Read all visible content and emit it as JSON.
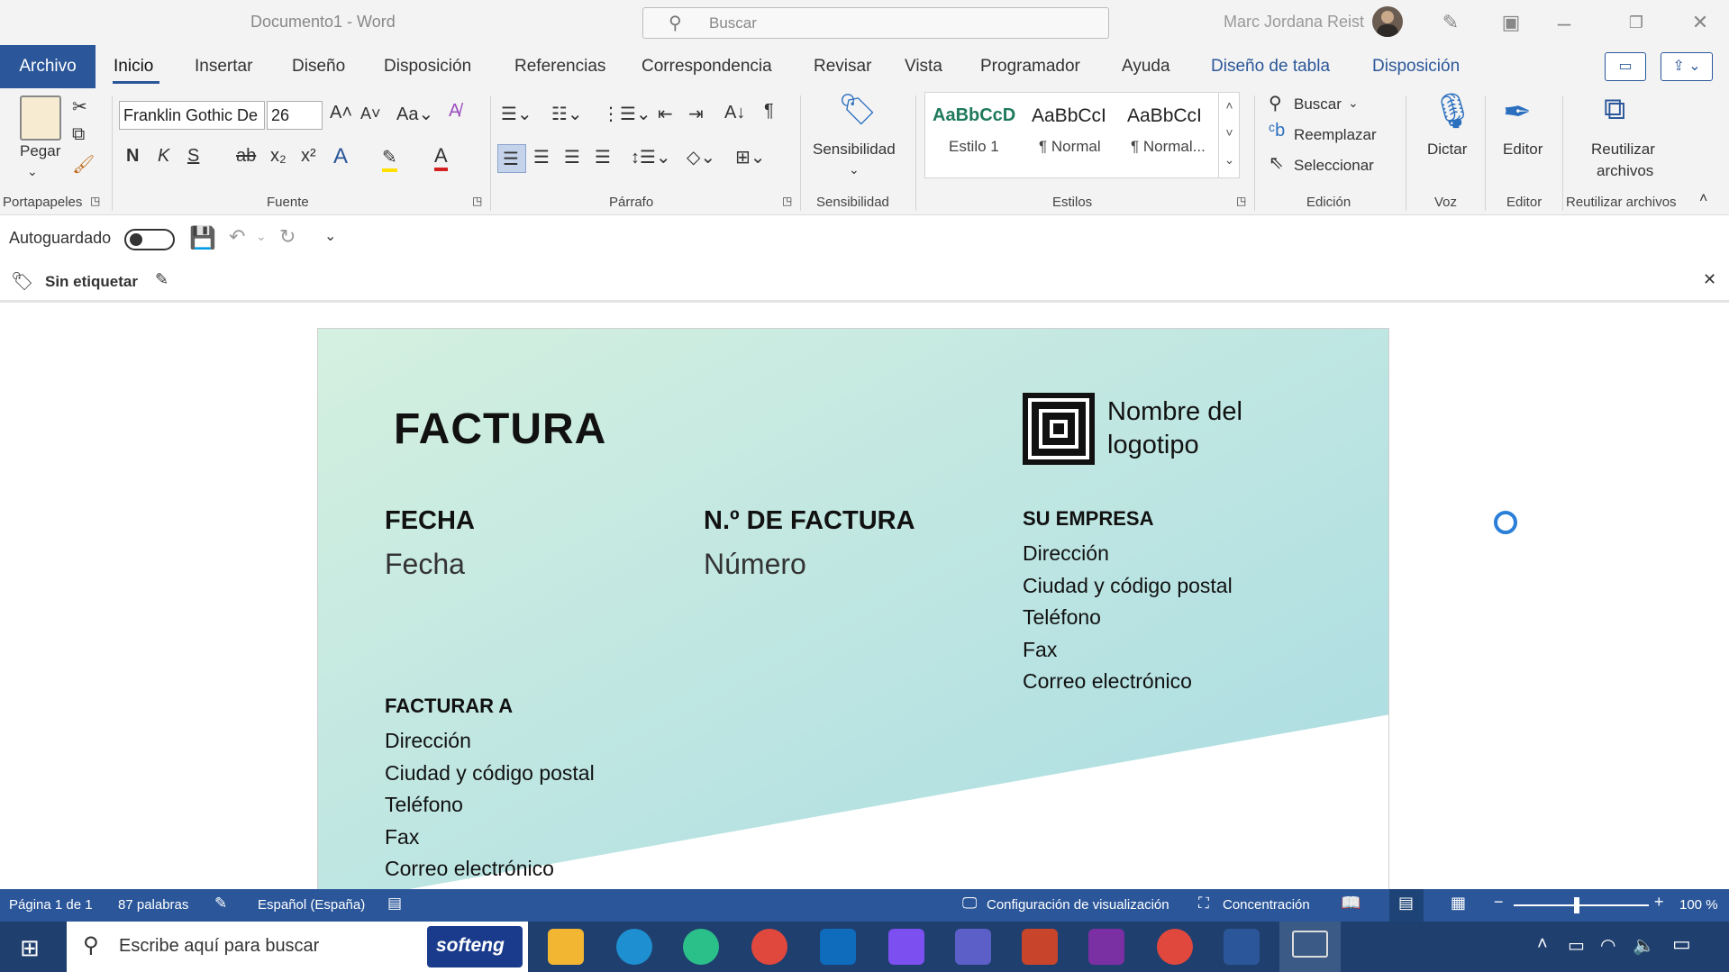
{
  "window": {
    "doc_title": "Documento1  -  Word",
    "search_placeholder": "Buscar",
    "user_name": "Marc Jordana Reist"
  },
  "tabs": [
    "Archivo",
    "Inicio",
    "Insertar",
    "Diseño",
    "Disposición",
    "Referencias",
    "Correspondencia",
    "Revisar",
    "Vista",
    "Programador",
    "Ayuda",
    "Diseño de tabla",
    "Disposición"
  ],
  "ribbon": {
    "clipboard": {
      "paste": "Pegar",
      "group": "Portapapeles"
    },
    "font": {
      "name": "Franklin Gothic De",
      "size": "26",
      "group": "Fuente",
      "bold": "N",
      "italic": "K",
      "underline": "S"
    },
    "paragraph": {
      "group": "Párrafo"
    },
    "sensitivity": {
      "button": "Sensibilidad",
      "group": "Sensibilidad"
    },
    "styles": {
      "group": "Estilos",
      "items": [
        {
          "preview": "AaBbCcD",
          "name": "Estilo 1"
        },
        {
          "preview": "AaBbCcI",
          "name": "¶ Normal"
        },
        {
          "preview": "AaBbCcI",
          "name": "¶ Normal..."
        }
      ]
    },
    "editing": {
      "find": "Buscar",
      "replace": "Reemplazar",
      "select": "Seleccionar",
      "group": "Edición"
    },
    "voice": {
      "dictate": "Dictar",
      "group": "Voz"
    },
    "editor": {
      "button": "Editor",
      "group": "Editor"
    },
    "reuse": {
      "button_line1": "Reutilizar",
      "button_line2": "archivos",
      "group": "Reutilizar archivos"
    }
  },
  "qat": {
    "autosave": "Autoguardado"
  },
  "labelbar": {
    "label": "Sin etiquetar"
  },
  "document": {
    "title": "FACTURA",
    "logo_line1": "Nombre del",
    "logo_line2": "logotipo",
    "fecha_label": "FECHA",
    "fecha_value": "Fecha",
    "invoice_label": "N.º DE FACTURA",
    "invoice_value": "Número",
    "company_label": "SU EMPRESA",
    "company_lines": [
      "Dirección",
      "Ciudad y código postal",
      "Teléfono",
      "Fax",
      "Correo electrónico"
    ],
    "billto_label": "FACTURAR A",
    "billto_lines": [
      "Dirección",
      "Ciudad y código postal",
      "Teléfono",
      "Fax",
      "Correo electrónico"
    ]
  },
  "statusbar": {
    "page": "Página 1 de 1",
    "words": "87 palabras",
    "language": "Español (España)",
    "display_settings": "Configuración de visualización",
    "focus": "Concentración",
    "zoom": "100 %",
    "zoom_level_percent": 100
  },
  "taskbar": {
    "search": "Escribe aquí para buscar",
    "brand": "softeng"
  },
  "colors": {
    "accent": "#2b579a",
    "gradient_start": "#d4f0e0",
    "gradient_end": "#a8dbe3"
  }
}
